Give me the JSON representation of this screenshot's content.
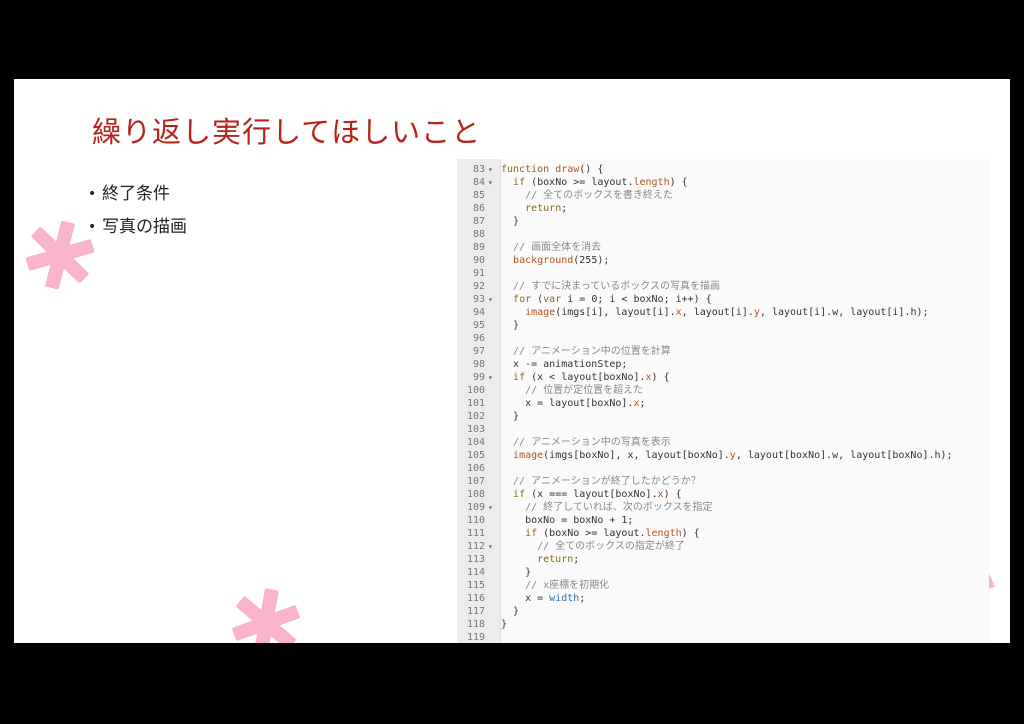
{
  "slide": {
    "title": "繰り返し実行してほしいこと",
    "bullets": [
      "終了条件",
      "写真の描画"
    ]
  },
  "colors": {
    "title": "#b8221a",
    "accent_deco": "#f9b3cb",
    "keyword": "#8a6a1d",
    "function": "#b4541f",
    "comment": "#888888"
  },
  "icons": {
    "bullet": "bullet-dot-icon",
    "fold": "fold-arrow-icon",
    "decoration": "pink-asterisk-icon"
  },
  "editor": {
    "lines": [
      {
        "n": "83",
        "fold": true,
        "tokens": [
          [
            "kw",
            "function "
          ],
          [
            "fn",
            "draw"
          ],
          [
            "plain",
            "() {"
          ]
        ]
      },
      {
        "n": "84",
        "fold": true,
        "tokens": [
          [
            "plain",
            "  "
          ],
          [
            "kw",
            "if"
          ],
          [
            "plain",
            " (boxNo >= layout."
          ],
          [
            "prop",
            "length"
          ],
          [
            "plain",
            ") {"
          ]
        ]
      },
      {
        "n": "85",
        "fold": false,
        "tokens": [
          [
            "com",
            "    // 全てのボックスを書き終えた"
          ]
        ]
      },
      {
        "n": "86",
        "fold": false,
        "tokens": [
          [
            "plain",
            "    "
          ],
          [
            "kw",
            "return"
          ],
          [
            "plain",
            ";"
          ]
        ]
      },
      {
        "n": "87",
        "fold": false,
        "tokens": [
          [
            "plain",
            "  }"
          ]
        ]
      },
      {
        "n": "88",
        "fold": false,
        "tokens": []
      },
      {
        "n": "89",
        "fold": false,
        "tokens": [
          [
            "com",
            "  // 画面全体を消去"
          ]
        ]
      },
      {
        "n": "90",
        "fold": false,
        "tokens": [
          [
            "plain",
            "  "
          ],
          [
            "fn",
            "background"
          ],
          [
            "plain",
            "(255);"
          ]
        ]
      },
      {
        "n": "91",
        "fold": false,
        "tokens": []
      },
      {
        "n": "92",
        "fold": false,
        "tokens": [
          [
            "com",
            "  // すでに決まっているボックスの写真を描画"
          ]
        ]
      },
      {
        "n": "93",
        "fold": true,
        "tokens": [
          [
            "plain",
            "  "
          ],
          [
            "kw",
            "for"
          ],
          [
            "plain",
            " ("
          ],
          [
            "kw",
            "var"
          ],
          [
            "plain",
            " i = 0; i < boxNo; i++) {"
          ]
        ]
      },
      {
        "n": "94",
        "fold": false,
        "tokens": [
          [
            "plain",
            "    "
          ],
          [
            "fn",
            "image"
          ],
          [
            "plain",
            "(imgs[i], layout[i]."
          ],
          [
            "prop",
            "x"
          ],
          [
            "plain",
            ", layout[i]."
          ],
          [
            "prop",
            "y"
          ],
          [
            "plain",
            ", layout[i].w, layout[i].h);"
          ]
        ]
      },
      {
        "n": "95",
        "fold": false,
        "tokens": [
          [
            "plain",
            "  }"
          ]
        ]
      },
      {
        "n": "96",
        "fold": false,
        "tokens": []
      },
      {
        "n": "97",
        "fold": false,
        "tokens": [
          [
            "com",
            "  // アニメーション中の位置を計算"
          ]
        ]
      },
      {
        "n": "98",
        "fold": false,
        "tokens": [
          [
            "plain",
            "  x -= animationStep;"
          ]
        ]
      },
      {
        "n": "99",
        "fold": true,
        "tokens": [
          [
            "plain",
            "  "
          ],
          [
            "kw",
            "if"
          ],
          [
            "plain",
            " (x < layout[boxNo]."
          ],
          [
            "prop",
            "x"
          ],
          [
            "plain",
            ") {"
          ]
        ]
      },
      {
        "n": "100",
        "fold": false,
        "tokens": [
          [
            "com",
            "    // 位置が定位置を超えた"
          ]
        ]
      },
      {
        "n": "101",
        "fold": false,
        "tokens": [
          [
            "plain",
            "    x = layout[boxNo]."
          ],
          [
            "prop",
            "x"
          ],
          [
            "plain",
            ";"
          ]
        ]
      },
      {
        "n": "102",
        "fold": false,
        "tokens": [
          [
            "plain",
            "  }"
          ]
        ]
      },
      {
        "n": "103",
        "fold": false,
        "tokens": []
      },
      {
        "n": "104",
        "fold": false,
        "tokens": [
          [
            "com",
            "  // アニメーション中の写真を表示"
          ]
        ]
      },
      {
        "n": "105",
        "fold": false,
        "tokens": [
          [
            "plain",
            "  "
          ],
          [
            "fn",
            "image"
          ],
          [
            "plain",
            "(imgs[boxNo], x, layout[boxNo]."
          ],
          [
            "prop",
            "y"
          ],
          [
            "plain",
            ", layout[boxNo].w, layout[boxNo].h);"
          ]
        ]
      },
      {
        "n": "106",
        "fold": false,
        "tokens": []
      },
      {
        "n": "107",
        "fold": false,
        "tokens": [
          [
            "com",
            "  // アニメーションが終了したかどうか？"
          ]
        ]
      },
      {
        "n": "108",
        "fold": false,
        "tokens": [
          [
            "plain",
            "  "
          ],
          [
            "kw",
            "if"
          ],
          [
            "plain",
            " (x === layout[boxNo]."
          ],
          [
            "prop",
            "x"
          ],
          [
            "plain",
            ") {"
          ]
        ]
      },
      {
        "n": "109",
        "fold": true,
        "tokens": [
          [
            "com",
            "    // 終了していれば、次のボックスを指定"
          ]
        ]
      },
      {
        "n": "110",
        "fold": false,
        "tokens": [
          [
            "plain",
            "    boxNo = boxNo + 1;"
          ]
        ]
      },
      {
        "n": "111",
        "fold": false,
        "tokens": [
          [
            "plain",
            "    "
          ],
          [
            "kw",
            "if"
          ],
          [
            "plain",
            " (boxNo >= layout."
          ],
          [
            "prop",
            "length"
          ],
          [
            "plain",
            ") {"
          ]
        ]
      },
      {
        "n": "112",
        "fold": true,
        "tokens": [
          [
            "com",
            "      // 全てのボックスの指定が終了"
          ]
        ]
      },
      {
        "n": "113",
        "fold": false,
        "tokens": [
          [
            "plain",
            "      "
          ],
          [
            "kw",
            "return"
          ],
          [
            "plain",
            ";"
          ]
        ]
      },
      {
        "n": "114",
        "fold": false,
        "tokens": [
          [
            "plain",
            "    }"
          ]
        ]
      },
      {
        "n": "115",
        "fold": false,
        "tokens": [
          [
            "com",
            "    // x座標を初期化"
          ]
        ]
      },
      {
        "n": "116",
        "fold": false,
        "tokens": [
          [
            "plain",
            "    x = "
          ],
          [
            "blue",
            "width"
          ],
          [
            "plain",
            ";"
          ]
        ]
      },
      {
        "n": "117",
        "fold": false,
        "tokens": [
          [
            "plain",
            "  }"
          ]
        ]
      },
      {
        "n": "118",
        "fold": false,
        "tokens": [
          [
            "plain",
            "}"
          ]
        ]
      },
      {
        "n": "119",
        "fold": false,
        "tokens": []
      }
    ]
  }
}
